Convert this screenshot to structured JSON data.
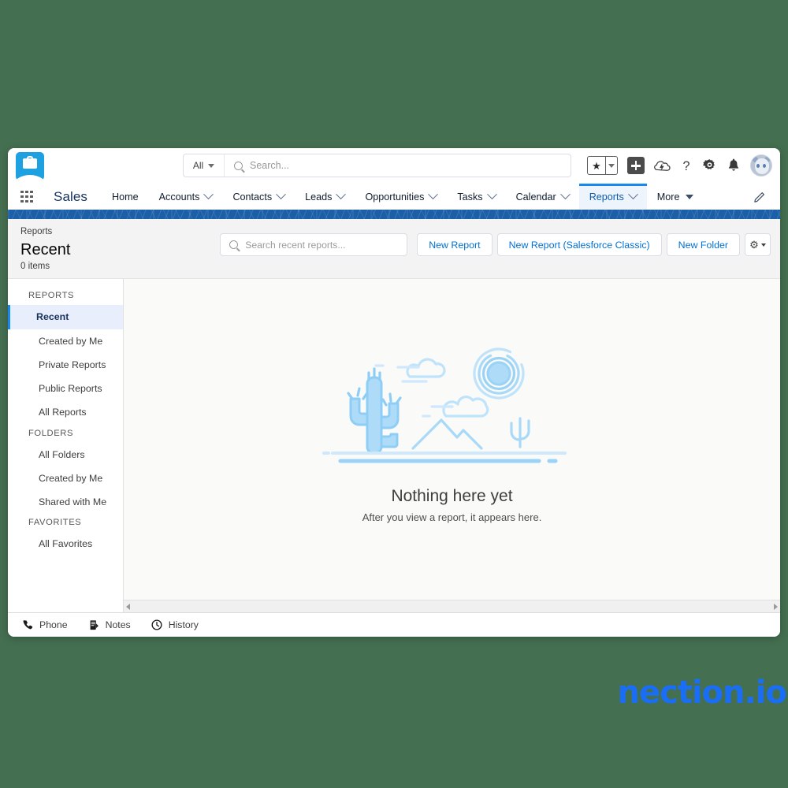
{
  "app": {
    "logo_icon": "salesforce-cloud-icon",
    "app_name": "Sales"
  },
  "global_search": {
    "scope_label": "All",
    "scope_caret_icon": "caret-down-icon",
    "search_icon": "search-icon",
    "placeholder": "Search..."
  },
  "header_icons": [
    {
      "name": "favorites-star-icon",
      "glyph": "★"
    },
    {
      "name": "favorites-caret-icon",
      "glyph": "▾"
    },
    {
      "name": "global-actions-plus-icon",
      "glyph": "+"
    },
    {
      "name": "learning-cloud-icon",
      "glyph": "⛅"
    },
    {
      "name": "help-icon",
      "glyph": "?"
    },
    {
      "name": "setup-gear-icon",
      "glyph": "⚙"
    },
    {
      "name": "notifications-bell-icon",
      "glyph": "🔔"
    },
    {
      "name": "user-avatar",
      "glyph": ""
    }
  ],
  "nav": {
    "app_launcher_icon": "app-launcher-grid-icon",
    "items": [
      {
        "label": "Home",
        "has_caret": false,
        "active": false
      },
      {
        "label": "Accounts",
        "has_caret": true,
        "active": false
      },
      {
        "label": "Contacts",
        "has_caret": true,
        "active": false
      },
      {
        "label": "Leads",
        "has_caret": true,
        "active": false
      },
      {
        "label": "Opportunities",
        "has_caret": true,
        "active": false
      },
      {
        "label": "Tasks",
        "has_caret": true,
        "active": false
      },
      {
        "label": "Calendar",
        "has_caret": true,
        "active": false
      },
      {
        "label": "Reports",
        "has_caret": true,
        "active": true
      },
      {
        "label": "More",
        "has_caret": true,
        "active": false
      }
    ],
    "edit_pencil_icon": "pencil-icon"
  },
  "page_header": {
    "breadcrumb": "Reports",
    "title": "Recent",
    "item_count": "0 items",
    "search": {
      "search_icon": "search-icon",
      "placeholder": "Search recent reports..."
    },
    "buttons": [
      {
        "label": "New Report"
      },
      {
        "label": "New Report (Salesforce Classic)"
      },
      {
        "label": "New Folder"
      }
    ],
    "settings_button": {
      "icon": "gear-icon",
      "caret_icon": "caret-down-icon"
    }
  },
  "sidebar": {
    "sections": [
      {
        "heading": "REPORTS",
        "items": [
          {
            "label": "Recent",
            "active": true
          },
          {
            "label": "Created by Me",
            "active": false
          },
          {
            "label": "Private Reports",
            "active": false
          },
          {
            "label": "Public Reports",
            "active": false
          },
          {
            "label": "All Reports",
            "active": false
          }
        ]
      },
      {
        "heading": "FOLDERS",
        "items": [
          {
            "label": "All Folders",
            "active": false
          },
          {
            "label": "Created by Me",
            "active": false
          },
          {
            "label": "Shared with Me",
            "active": false
          }
        ]
      },
      {
        "heading": "FAVORITES",
        "items": [
          {
            "label": "All Favorites",
            "active": false
          }
        ]
      }
    ]
  },
  "empty_state": {
    "illustration": "desert-scene-illustration",
    "title": "Nothing here yet",
    "subtitle": "After you view a report, it appears here."
  },
  "scrollbar": {
    "left_arrow_icon": "scroll-left-arrow-icon",
    "right_arrow_icon": "scroll-right-arrow-icon"
  },
  "utility_bar": {
    "items": [
      {
        "label": "Phone",
        "icon": "phone-icon"
      },
      {
        "label": "Notes",
        "icon": "notes-icon"
      },
      {
        "label": "History",
        "icon": "clock-icon"
      }
    ]
  },
  "watermark": {
    "text": "nection.io",
    "color": "#1a6ef5"
  },
  "colors": {
    "page_background": "#456f51",
    "brand_blue": "#1589ee",
    "link_blue": "#0070d2",
    "nav_band": "#1b5fa8",
    "illustration_light": "#cfe8fb",
    "illustration_mid": "#aedcf8",
    "illustration_stroke": "#8ecdf5"
  }
}
